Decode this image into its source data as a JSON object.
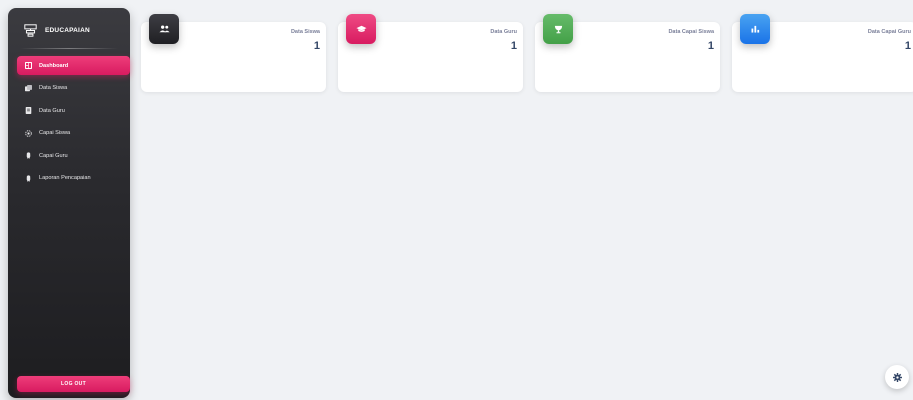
{
  "brand": {
    "name": "EDUCAPAIAN",
    "icon": "institution-icon"
  },
  "sidebar": {
    "items": [
      {
        "label": "Dashboard",
        "icon": "dashboard-icon",
        "active": true
      },
      {
        "label": "Data Siswa",
        "icon": "students-icon",
        "active": false
      },
      {
        "label": "Data Guru",
        "icon": "book-icon",
        "active": false
      },
      {
        "label": "Capai Siswa",
        "icon": "target-icon",
        "active": false
      },
      {
        "label": "Capai Guru",
        "icon": "award-icon",
        "active": false
      },
      {
        "label": "Laporan Pencapaian",
        "icon": "report-icon",
        "active": false
      }
    ],
    "logout_label": "LOG OUT"
  },
  "cards": [
    {
      "title": "Data Siswa",
      "value": "1",
      "icon": "people-icon",
      "color": "#2f2f34"
    },
    {
      "title": "Data Guru",
      "value": "1",
      "icon": "graduation-cap-icon",
      "color": "#e91e63"
    },
    {
      "title": "Data Capai Siswa",
      "value": "1",
      "icon": "trophy-icon",
      "color": "#4caf50"
    },
    {
      "title": "Data Capai Guru",
      "value": "1",
      "icon": "bar-chart-icon",
      "color": "#1a73e8"
    }
  ],
  "colors": {
    "accent": "#e91e63",
    "sidebar_bg": "#2a2a2e",
    "page_bg": "#f0f2f5"
  },
  "settings": {
    "icon": "gear-icon"
  }
}
